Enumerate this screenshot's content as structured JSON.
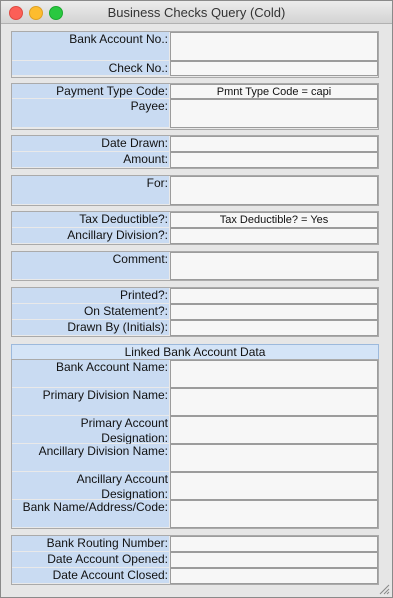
{
  "window": {
    "title": "Business Checks Query (Cold)"
  },
  "fields": {
    "bank_account_no": {
      "label": "Bank Account No.:",
      "value": ""
    },
    "check_no": {
      "label": "Check No.:",
      "value": ""
    },
    "payment_type_code": {
      "label": "Payment Type Code:",
      "value": "Pmnt Type Code = capi"
    },
    "payee": {
      "label": "Payee:",
      "value": ""
    },
    "date_drawn": {
      "label": "Date Drawn:",
      "value": ""
    },
    "amount": {
      "label": "Amount:",
      "value": ""
    },
    "for": {
      "label": "For:",
      "value": ""
    },
    "tax_deductible": {
      "label": "Tax Deductible?:",
      "value": "Tax Deductible? = Yes"
    },
    "ancillary_division": {
      "label": "Ancillary Division?:",
      "value": ""
    },
    "comment": {
      "label": "Comment:",
      "value": ""
    },
    "printed": {
      "label": "Printed?:",
      "value": ""
    },
    "on_statement": {
      "label": "On Statement?:",
      "value": ""
    },
    "drawn_by": {
      "label": "Drawn By (Initials):",
      "value": ""
    }
  },
  "linked": {
    "header": "Linked Bank Account Data",
    "bank_account_name": {
      "label": "Bank Account Name:",
      "value": ""
    },
    "primary_division_name": {
      "label": "Primary Division Name:",
      "value": ""
    },
    "primary_account_designation": {
      "label_line1": "Primary Account",
      "label_line2": "Designation:",
      "value": ""
    },
    "ancillary_division_name": {
      "label": "Ancillary Division Name:",
      "value": ""
    },
    "ancillary_account_designation": {
      "label_line1": "Ancillary Account",
      "label_line2": "Designation:",
      "value": ""
    },
    "bank_name_address_code": {
      "label": "Bank Name/Address/Code:",
      "value": ""
    },
    "bank_routing_number": {
      "label": "Bank Routing Number:",
      "value": ""
    },
    "date_account_opened": {
      "label": "Date Account Opened:",
      "value": ""
    },
    "date_account_closed": {
      "label": "Date Account Closed:",
      "value": ""
    }
  }
}
